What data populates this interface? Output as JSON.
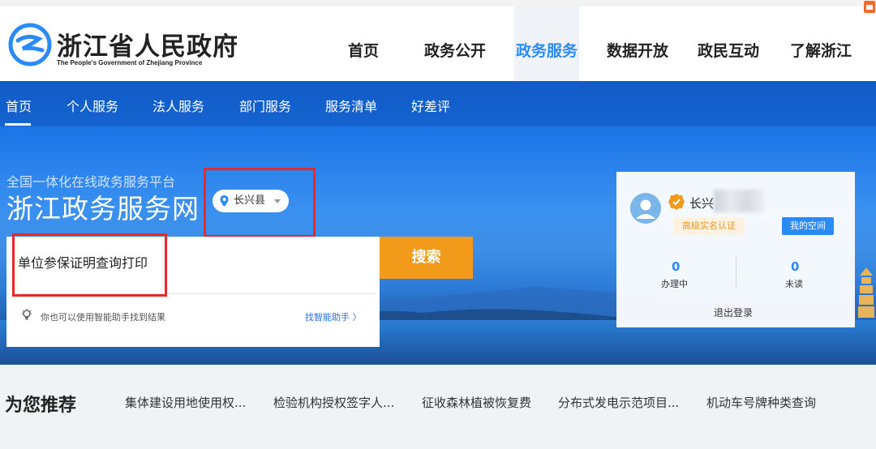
{
  "site": {
    "title": "浙江省人民政府",
    "subtitle": "The People's Government of Zhejiang Province"
  },
  "main_nav": [
    "首页",
    "政务公开",
    "政务服务",
    "数据开放",
    "政民互动",
    "了解浙江"
  ],
  "main_nav_active": "政务服务",
  "sub_nav": [
    "首页",
    "个人服务",
    "法人服务",
    "部门服务",
    "服务清单",
    "好差评"
  ],
  "sub_nav_active": "首页",
  "hero": {
    "platform_label": "全国一体化在线政务服务平台",
    "title": "浙江政务服务网",
    "location": "长兴县"
  },
  "search": {
    "value": "单位参保证明查询打印",
    "button": "搜索",
    "hint": "你也可以使用智能助手找到结果",
    "assistant_link": "找智能助手 〉"
  },
  "user": {
    "name": "长兴",
    "verified_label": "高级实名认证",
    "my_space": "我的空间",
    "in_progress_count": "0",
    "in_progress_label": "办理中",
    "unread_count": "0",
    "unread_label": "未读",
    "logout": "退出登录"
  },
  "recommendations": {
    "title": "为您推荐",
    "items": [
      "集体建设用地使用权...",
      "检验机构授权签字人...",
      "征收森林植被恢复费",
      "分布式发电示范项目...",
      "机动车号牌种类查询"
    ]
  },
  "colors": {
    "accent": "#2a8af6",
    "search_button": "#f29a1a",
    "highlight_box": "#e8292b"
  }
}
